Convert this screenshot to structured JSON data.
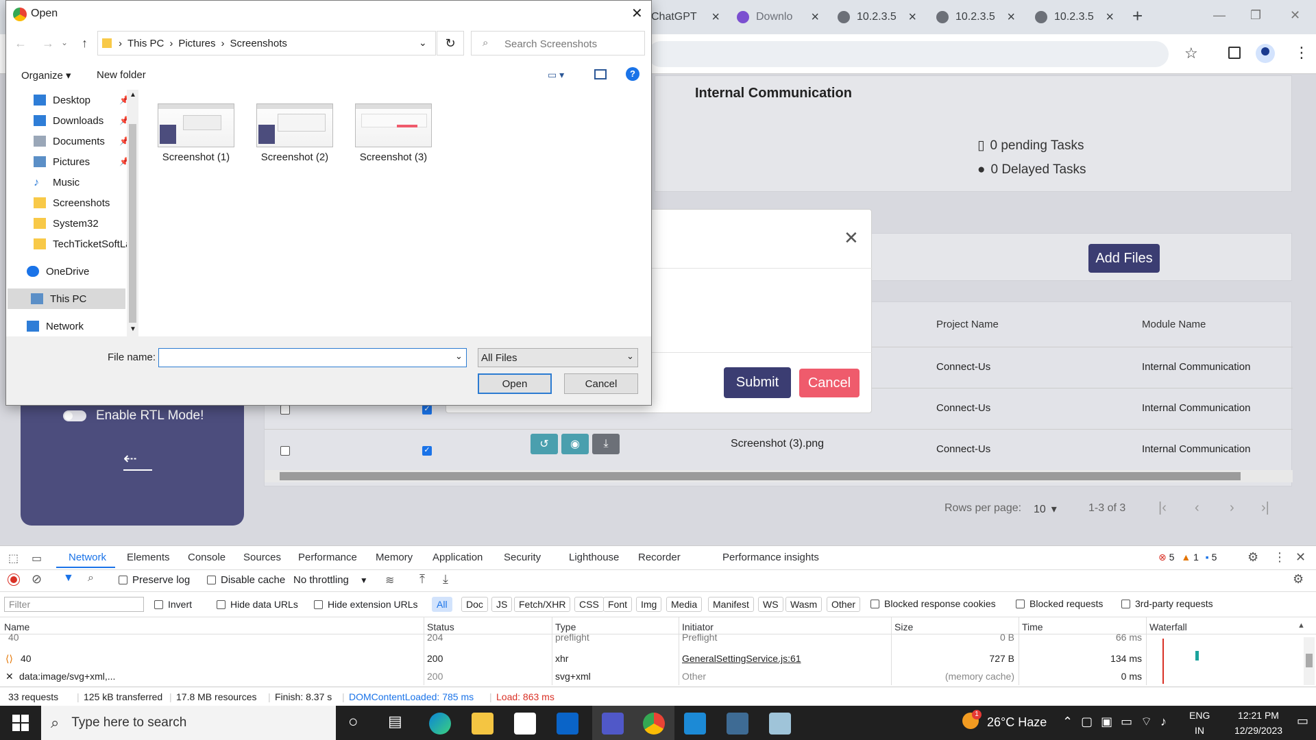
{
  "browser": {
    "tabs": [
      {
        "label": "ChatGPT"
      },
      {
        "label": "Downlo"
      },
      {
        "label": "10.2.3.5"
      },
      {
        "label": "10.2.3.5"
      },
      {
        "label": "10.2.3.5"
      }
    ],
    "new_tab": "+",
    "window_controls": {
      "minimize": "—",
      "maximize": "❐",
      "close": "✕"
    }
  },
  "page": {
    "section_title": "Internal Communication",
    "stats": {
      "pending": "0 pending Tasks",
      "delayed": "0 Delayed Tasks"
    },
    "add_files": "Add Files",
    "modal": {
      "submit": "Submit",
      "cancel": "Cancel",
      "close": "✕"
    },
    "rtl_toggle_label": "Enable RTL Mode!",
    "table": {
      "headers": [
        "Project Name",
        "Module Name"
      ],
      "rows": [
        {
          "file": "",
          "project": "Connect-Us",
          "module": "Internal Communication",
          "checked": false
        },
        {
          "file": "",
          "project": "Connect-Us",
          "module": "Internal Communication",
          "checked": true
        },
        {
          "file": "Screenshot (3).png",
          "project": "Connect-Us",
          "module": "Internal Communication",
          "checked": true
        }
      ],
      "rows_per_page_label": "Rows per page:",
      "rows_per_page_value": "10",
      "range": "1-3 of 3"
    }
  },
  "dialog": {
    "title": "Open",
    "breadcrumb": [
      "This PC",
      "Pictures",
      "Screenshots"
    ],
    "search_placeholder": "Search Screenshots",
    "toolbar": {
      "organize": "Organize",
      "new_folder": "New folder"
    },
    "nav": [
      {
        "label": "Desktop",
        "pinned": true
      },
      {
        "label": "Downloads",
        "pinned": true
      },
      {
        "label": "Documents",
        "pinned": true
      },
      {
        "label": "Pictures",
        "pinned": true
      },
      {
        "label": "Music",
        "pinned": false
      },
      {
        "label": "Screenshots",
        "pinned": false
      },
      {
        "label": "System32",
        "pinned": false
      },
      {
        "label": "TechTicketSoftLa",
        "pinned": false
      },
      {
        "label": "OneDrive",
        "pinned": false
      },
      {
        "label": "This PC",
        "pinned": false
      },
      {
        "label": "Network",
        "pinned": false
      }
    ],
    "files": [
      {
        "label": "Screenshot (1)"
      },
      {
        "label": "Screenshot (2)"
      },
      {
        "label": "Screenshot (3)"
      }
    ],
    "file_name_label": "File name:",
    "file_name_value": "",
    "file_type": "All Files",
    "open": "Open",
    "cancel": "Cancel"
  },
  "devtools": {
    "tabs": [
      "Network",
      "Elements",
      "Console",
      "Sources",
      "Performance",
      "Memory",
      "Application",
      "Security",
      "Lighthouse",
      "Recorder",
      "Performance insights"
    ],
    "counts": {
      "errors": "5",
      "warnings": "1",
      "messages": "5"
    },
    "toolbar": {
      "preserve_log": "Preserve log",
      "disable_cache": "Disable cache",
      "throttling": "No throttling"
    },
    "filter_placeholder": "Filter",
    "filter_checks": {
      "invert": "Invert",
      "hide_data": "Hide data URLs",
      "hide_ext": "Hide extension URLs"
    },
    "type_filters": [
      "All",
      "Doc",
      "JS",
      "Fetch/XHR",
      "CSS",
      "Font",
      "Img",
      "Media",
      "Manifest",
      "WS",
      "Wasm",
      "Other"
    ],
    "extra_checks": {
      "blocked_cookies": "Blocked response cookies",
      "blocked_requests": "Blocked requests",
      "third_party": "3rd-party requests"
    },
    "columns": [
      "Name",
      "Status",
      "Type",
      "Initiator",
      "Size",
      "Time",
      "Waterfall"
    ],
    "rows": [
      {
        "name": "40",
        "status": "204",
        "type": "preflight",
        "initiator": "Preflight",
        "size": "0 B",
        "time": "66 ms"
      },
      {
        "name": "40",
        "status": "200",
        "type": "xhr",
        "initiator": "GeneralSettingService.js:61",
        "size": "727 B",
        "time": "134 ms"
      },
      {
        "name": "data:image/svg+xml,...",
        "status": "200",
        "type": "svg+xml",
        "initiator": "Other",
        "size": "(memory cache)",
        "time": "0 ms"
      }
    ],
    "status_bar": {
      "requests": "33 requests",
      "transferred": "125 kB transferred",
      "resources": "17.8 MB resources",
      "finish": "Finish: 8.37 s",
      "dcl": "DOMContentLoaded: 785 ms",
      "load": "Load: 863 ms"
    }
  },
  "taskbar": {
    "search_placeholder": "Type here to search",
    "weather": "26°C  Haze",
    "lang": "ENG",
    "region": "IN",
    "time": "12:21 PM",
    "date": "12/29/2023",
    "weather_badge": "1"
  },
  "colors": {
    "accent": "#3b3d72",
    "danger": "#ef5b6c",
    "sidebar": "#4c4d7d",
    "teal": "#4a9fae",
    "link_blue": "#1a73e8",
    "load_red": "#d93025"
  }
}
